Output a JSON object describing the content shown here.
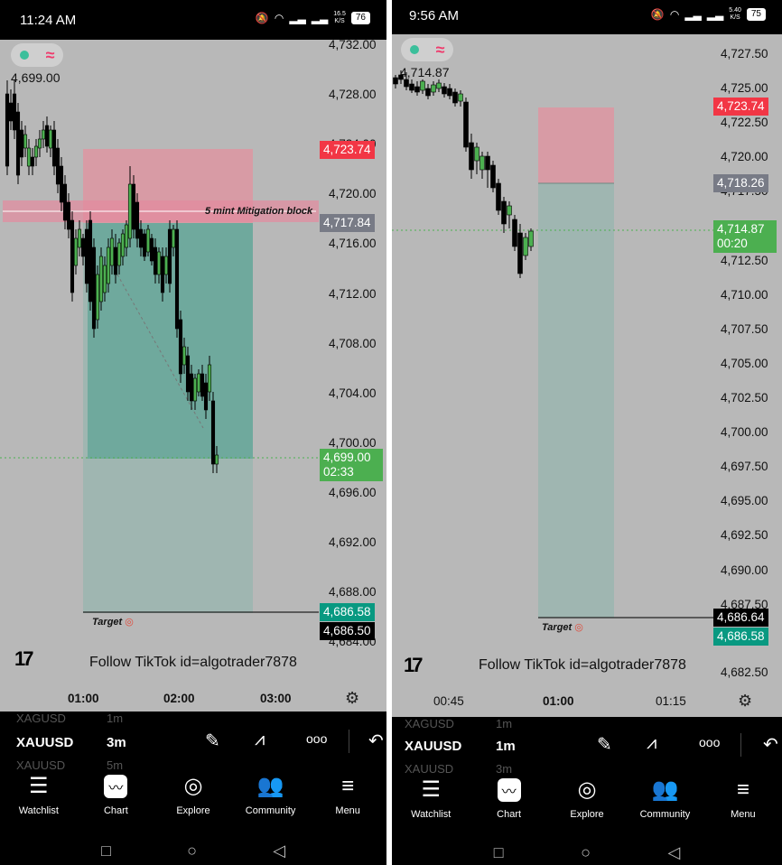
{
  "left": {
    "status": {
      "time": "11:24 AM",
      "speed": "16.5",
      "speed_unit": "K/S",
      "battery": "76"
    },
    "chart": {
      "yaxis": [
        "4,732.00",
        "4,728.00",
        "4,724.00",
        "4,720.00",
        "4,716.00",
        "4,712.00",
        "4,708.00",
        "4,704.00",
        "4,700.00",
        "4,696.00",
        "4,692.00",
        "4,688.00",
        "4,684.00"
      ],
      "ohlc_label": "4,699.00",
      "price_red": "4,723.74",
      "price_gray": "4,717.84",
      "price_current": "4,699.00",
      "countdown": "02:33",
      "price_teal": "4,686.58",
      "price_black": "4,686.50",
      "mitigation_label": "5 mint Mitigation block",
      "target_label": "Target",
      "follow_text": "Follow TikTok id=algotrader7878",
      "xaxis": [
        "01:00",
        "02:00",
        "03:00"
      ]
    },
    "symbar": {
      "symbol": "XAUUSD",
      "timeframe": "3m",
      "ghost_symbol": "XAGUSD",
      "ghost_tf_top": "1m",
      "ghost_tf_bottom": "5m",
      "ghost_bottom": "XAUUSD"
    }
  },
  "right": {
    "status": {
      "time": "9:56 AM",
      "speed": "5.40",
      "speed_unit": "K/S",
      "battery": "75"
    },
    "chart": {
      "yaxis": [
        "4,727.50",
        "4,725.00",
        "4,722.50",
        "4,720.00",
        "4,717.50",
        "4,715.00",
        "4,712.50",
        "4,710.00",
        "4,707.50",
        "4,705.00",
        "4,702.50",
        "4,700.00",
        "4,697.50",
        "4,695.00",
        "4,692.50",
        "4,690.00",
        "4,687.50",
        "4,682.50"
      ],
      "ohlc_label": "4,714.87",
      "price_red": "4,723.74",
      "price_gray": "4,718.26",
      "price_current": "4,714.87",
      "countdown": "00:20",
      "price_black": "4,686.64",
      "price_teal": "4,686.58",
      "target_label": "Target",
      "follow_text": "Follow TikTok id=algotrader7878",
      "xaxis": [
        "00:45",
        "01:00",
        "01:15"
      ]
    },
    "symbar": {
      "symbol": "XAUUSD",
      "timeframe": "1m",
      "ghost_symbol": "XAGUSD",
      "ghost_tf_top": "1m",
      "ghost_tf_bottom": "3m",
      "ghost_bottom": "XAUUSD"
    }
  },
  "nav": {
    "watchlist": "Watchlist",
    "chart": "Chart",
    "explore": "Explore",
    "community": "Community",
    "menu": "Menu"
  },
  "icons": {
    "draw": "pencil-icon",
    "patterns": "trend-lines-icon",
    "more": "more-icon",
    "undo": "undo-icon",
    "settings": "settings-icon",
    "watchlist": "watchlist-icon",
    "chart": "chart-icon",
    "explore": "compass-icon",
    "community": "people-icon",
    "menu": "menu-icon",
    "tv_logo": "tradingview-logo",
    "indicator": "indicator-toggle-icon"
  },
  "colors": {
    "bull": "#4caf50",
    "bear": "#000000",
    "stop_zone": "#d99aa3",
    "target_zone": "#6faea2",
    "red_price": "#f23645",
    "green_price": "#4caf50",
    "teal_price": "#089981",
    "gray_price": "#787b86"
  }
}
